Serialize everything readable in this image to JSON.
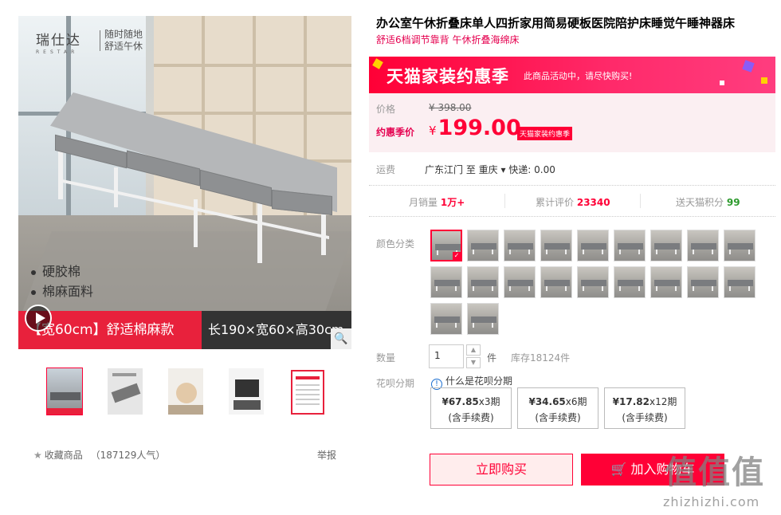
{
  "gallery": {
    "brand": "瑞仕达",
    "brand_en": "RESTAR",
    "slogan_line1": "随时随地",
    "slogan_line2": "舒适午休",
    "bullet1": "硬胶棉",
    "bullet2": "棉麻面料",
    "banner_left": "【宽60cm】舒适棉麻款",
    "banner_right": "长190×宽60×高30cm",
    "thumb_count": 5
  },
  "favorites": {
    "label": "收藏商品",
    "count": "（187129人气）",
    "report": "举报"
  },
  "product": {
    "title": "办公室午休折叠床单人四折家用简易硬板医院陪护床睡觉午睡神器床",
    "subtitle": "舒适6档调节靠背 午休折叠海绵床"
  },
  "promo": {
    "headline": "天猫家装约惠季",
    "note": "此商品活动中，请尽快购买!"
  },
  "price": {
    "label": "价格",
    "original": "¥ 398.00",
    "deal_label": "约惠季价",
    "currency": "¥",
    "deal_value": "199.00",
    "deal_tag": "天猫家装约惠季"
  },
  "shipping": {
    "label": "运费",
    "value": "广东江门  至 重庆 ▾  快递: 0.00"
  },
  "stats": {
    "sales_label": "月销量",
    "sales_value": "1万+",
    "reviews_label": "累计评价",
    "reviews_value": "23340",
    "points_label": "送天猫积分",
    "points_value": "99"
  },
  "options": {
    "color_label": "颜色分类",
    "swatch_count": 20,
    "selected_index": 0
  },
  "quantity": {
    "label": "数量",
    "value": "1",
    "unit": "件",
    "stock": "库存18124件"
  },
  "installments": {
    "label": "花呗分期",
    "link": "什么是花呗分期",
    "plans": [
      {
        "amount": "¥67.85",
        "periods": "x3期",
        "fee": "(含手续费)"
      },
      {
        "amount": "¥34.65",
        "periods": "x6期",
        "fee": "(含手续费)"
      },
      {
        "amount": "¥17.82",
        "periods": "x12期",
        "fee": "(含手续费)"
      }
    ]
  },
  "actions": {
    "buy_now": "立即购买",
    "add_to_cart": "加入购物车"
  },
  "watermark": {
    "glyphs": "值值值",
    "site": "zhizhizhi.com"
  },
  "colors": {
    "accent": "#ff0036",
    "subtitle": "#e5004f",
    "points": "#2d9a2d",
    "link": "#1c6fd1"
  }
}
